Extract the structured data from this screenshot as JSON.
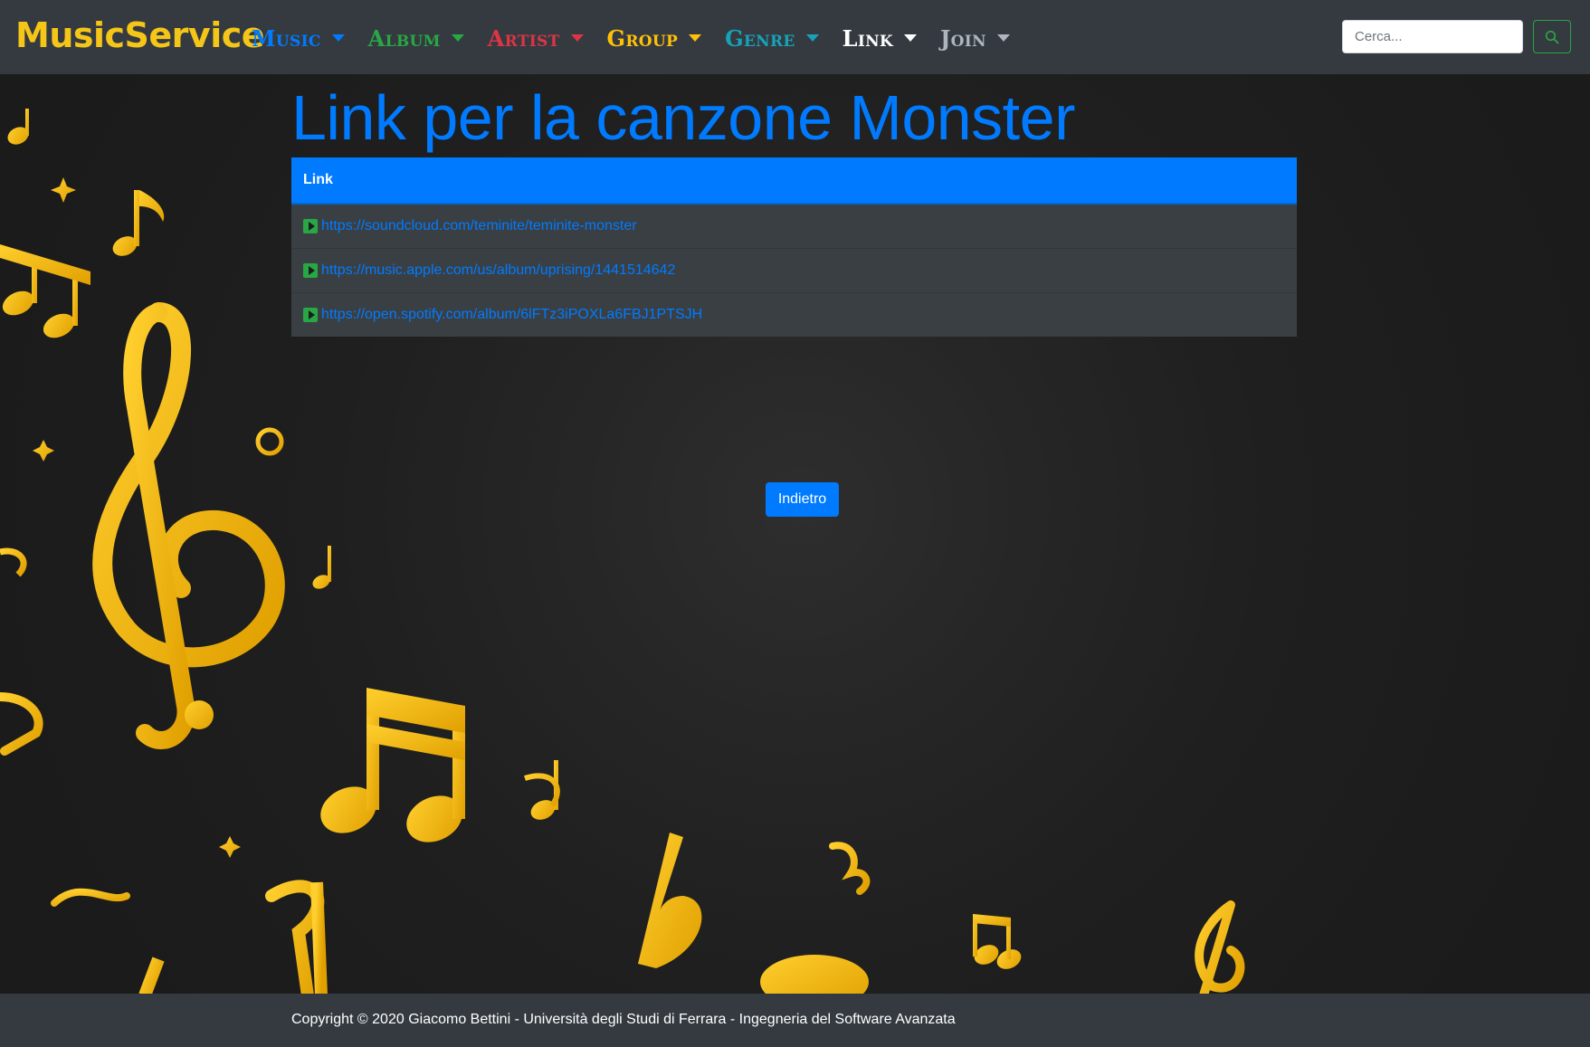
{
  "brand": "MusicService",
  "nav": {
    "items": [
      {
        "label": "Music",
        "color": "#007bff"
      },
      {
        "label": "Album",
        "color": "#28a745"
      },
      {
        "label": "Artist",
        "color": "#dc3545"
      },
      {
        "label": "Group",
        "color": "#ffc107"
      },
      {
        "label": "Genre",
        "color": "#17a2b8"
      },
      {
        "label": "Link",
        "color": "#ffffff"
      },
      {
        "label": "Join",
        "color": "#adb5bd"
      }
    ]
  },
  "search": {
    "placeholder": "Cerca...",
    "value": "",
    "button_icon": "search-icon"
  },
  "main": {
    "title": "Link per la canzone Monster",
    "table": {
      "header": "Link",
      "rows": [
        {
          "url": "https://soundcloud.com/teminite/teminite-monster",
          "icon": "play-icon"
        },
        {
          "url": "https://music.apple.com/us/album/uprising/1441514642",
          "icon": "play-icon"
        },
        {
          "url": "https://open.spotify.com/album/6lFTz3iPOXLa6FBJ1PTSJH",
          "icon": "play-icon"
        }
      ]
    },
    "back_button": "Indietro"
  },
  "footer": {
    "text": "Copyright © 2020 Giacomo Bettini - Università degli Studi di Ferrara - Ingegneria del Software Avanzata"
  },
  "colors": {
    "navbar": "#343a40",
    "accent": "#007bff",
    "brand": "#f5c518",
    "notes": "#f0b400"
  }
}
